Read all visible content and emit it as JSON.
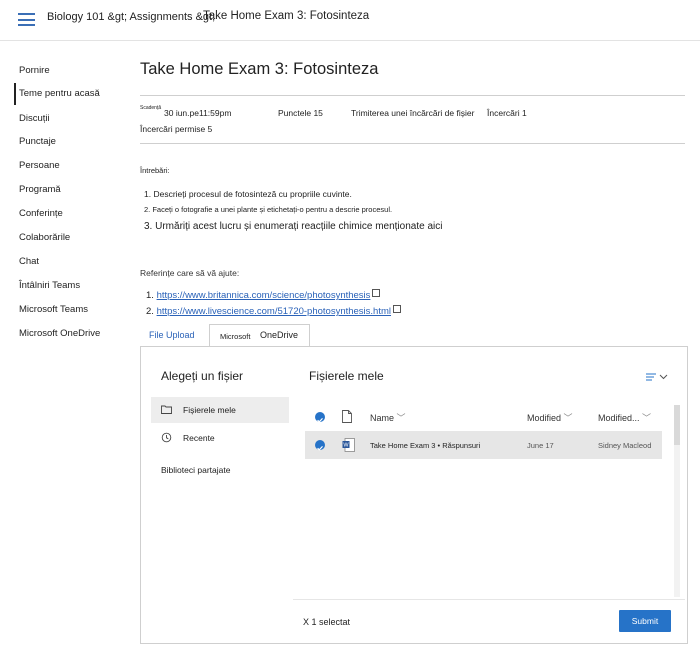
{
  "header": {
    "breadcrumb": "Biology 101 &gt; Assignments &gt;",
    "title": "Take Home Exam 3: Fotosinteza"
  },
  "sidebar": {
    "items": [
      {
        "label": "Pornire"
      },
      {
        "label": "Teme pentru acasă",
        "active": true
      },
      {
        "label": "Discuții"
      },
      {
        "label": "Punctaje"
      },
      {
        "label": "Persoane"
      },
      {
        "label": "Programă"
      },
      {
        "label": "Conferințe"
      },
      {
        "label": "Colaborările"
      },
      {
        "label": "Chat"
      },
      {
        "label": "Întâlniri Teams"
      },
      {
        "label": "Microsoft Teams"
      },
      {
        "label": "Microsoft OneDrive"
      }
    ]
  },
  "assignment": {
    "title": "Take Home Exam 3: Fotosinteza",
    "due_tag": "Scadență",
    "due": "30 iun.pe11:59pm",
    "points": "Punctele 15",
    "submission": "Trimiterea unei încărcări de fișier",
    "attempts": "Încercări 1",
    "allowed": "Încercări permise 5",
    "questions_label": "Întrebări:",
    "questions": [
      "Descrieți procesul de fotosinteză cu propriile cuvinte.",
      "Faceți o fotografie a unei plante și etichetați-o pentru a descrie procesul.",
      "Urmăriți acest lucru și enumerați reacțiile chimice menționate aici"
    ],
    "refs_label": "Referințe care să vă ajute:",
    "refs": [
      "https://www.britannica.com/science/photosynthesis",
      "https://www.livescience.com/51720-photosynthesis.html"
    ]
  },
  "tabs": {
    "file_upload": "File Upload",
    "onedrive_prefix": "Microsoft",
    "onedrive": "OneDrive"
  },
  "picker": {
    "title": "Alegeți un fișier",
    "left_items": [
      {
        "label": "Fișierele mele",
        "icon": "folder-icon",
        "selected": true
      },
      {
        "label": "Recente",
        "icon": "history-icon"
      },
      {
        "label": "Biblioteci partajate"
      }
    ],
    "right_title": "Fișierele mele",
    "columns": {
      "name": "Name",
      "modified": "Modified",
      "modified_by": "Modified..."
    },
    "files": [
      {
        "name": "Take Home Exam 3 • Răspunsuri",
        "modified": "June 17",
        "modified_by": "Sidney Macleod",
        "selected": true
      }
    ],
    "selected_count": "X 1 selectat",
    "submit": "Submit",
    "accent": "#2673c8"
  }
}
